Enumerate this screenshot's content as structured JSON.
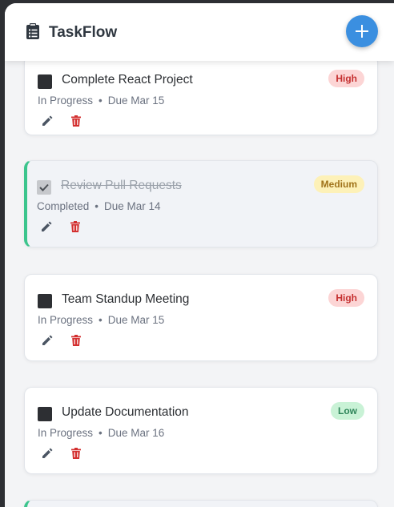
{
  "app": {
    "title": "TaskFlow",
    "add_button_label": "+"
  },
  "tasks": [
    {
      "title": "Complete React Project",
      "status": "In Progress",
      "due": "Due Mar 15",
      "priority": "High",
      "completed": false
    },
    {
      "title": "Review Pull Requests",
      "status": "Completed",
      "due": "Due Mar 14",
      "priority": "Medium",
      "completed": true
    },
    {
      "title": "Team Standup Meeting",
      "status": "In Progress",
      "due": "Due Mar 15",
      "priority": "High",
      "completed": false
    },
    {
      "title": "Update Documentation",
      "status": "In Progress",
      "due": "Due Mar 16",
      "priority": "Low",
      "completed": false
    }
  ],
  "meta_separator": "•",
  "colors": {
    "accent": "#3b8fe0",
    "completed_border": "#3cc58d",
    "delete": "#d32f2f",
    "edit": "#4b5563"
  },
  "icons": {
    "brand": "clipboard-icon",
    "add": "plus-icon",
    "edit": "pencil-icon",
    "delete": "trash-icon",
    "check": "check-icon"
  }
}
